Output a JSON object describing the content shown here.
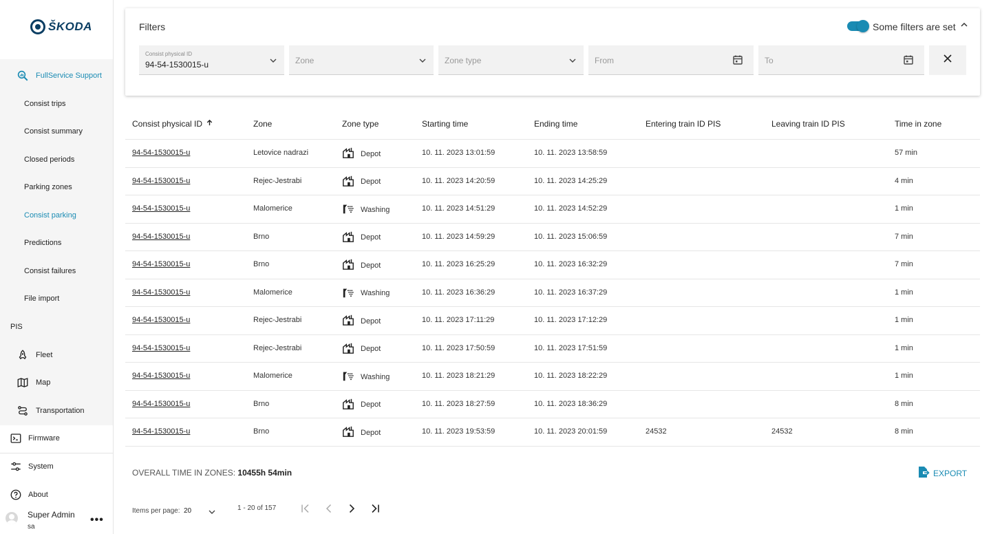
{
  "brand": {
    "name": "ŠKODA"
  },
  "sidebar": {
    "fullservice": {
      "label": "FullService Support"
    },
    "items": [
      {
        "label": "Consist trips"
      },
      {
        "label": "Consist summary"
      },
      {
        "label": "Closed periods"
      },
      {
        "label": "Parking zones"
      },
      {
        "label": "Consist parking",
        "active": true
      },
      {
        "label": "Predictions"
      },
      {
        "label": "Consist failures"
      },
      {
        "label": "File import"
      }
    ],
    "pis_label": "PIS",
    "pis_items": [
      {
        "label": "Fleet",
        "icon": "rocket-icon"
      },
      {
        "label": "Map",
        "icon": "map-icon"
      },
      {
        "label": "Transportation",
        "icon": "route-icon"
      }
    ],
    "firmware": {
      "label": "Firmware"
    },
    "system": {
      "label": "System"
    },
    "about": {
      "label": "About"
    },
    "user": {
      "name": "Super Admin",
      "login": "sa"
    }
  },
  "filters": {
    "title": "Filters",
    "toggle_label": "Some filters are set",
    "consist_id": {
      "label": "Consist physical ID",
      "value": "94-54-1530015-u"
    },
    "zone": {
      "placeholder": "Zone"
    },
    "zone_type": {
      "placeholder": "Zone type"
    },
    "from": {
      "placeholder": "From"
    },
    "to": {
      "placeholder": "To"
    }
  },
  "table": {
    "columns": [
      "Consist physical ID",
      "Zone",
      "Zone type",
      "Starting time",
      "Ending time",
      "Entering train ID PIS",
      "Leaving train ID PIS",
      "Time in zone"
    ],
    "rows": [
      {
        "id": "94-54-1530015-u",
        "zone": "Letovice nadrazi",
        "type": "Depot",
        "start": "10. 11. 2023 13:01:59",
        "end": "10. 11. 2023 13:58:59",
        "enter": "",
        "leave": "",
        "time": "57 min"
      },
      {
        "id": "94-54-1530015-u",
        "zone": "Rejec-Jestrabi",
        "type": "Depot",
        "start": "10. 11. 2023 14:20:59",
        "end": "10. 11. 2023 14:25:29",
        "enter": "",
        "leave": "",
        "time": "4 min"
      },
      {
        "id": "94-54-1530015-u",
        "zone": "Malomerice",
        "type": "Washing",
        "start": "10. 11. 2023 14:51:29",
        "end": "10. 11. 2023 14:52:29",
        "enter": "",
        "leave": "",
        "time": "1 min"
      },
      {
        "id": "94-54-1530015-u",
        "zone": "Brno",
        "type": "Depot",
        "start": "10. 11. 2023 14:59:29",
        "end": "10. 11. 2023 15:06:59",
        "enter": "",
        "leave": "",
        "time": "7 min"
      },
      {
        "id": "94-54-1530015-u",
        "zone": "Brno",
        "type": "Depot",
        "start": "10. 11. 2023 16:25:29",
        "end": "10. 11. 2023 16:32:29",
        "enter": "",
        "leave": "",
        "time": "7 min"
      },
      {
        "id": "94-54-1530015-u",
        "zone": "Malomerice",
        "type": "Washing",
        "start": "10. 11. 2023 16:36:29",
        "end": "10. 11. 2023 16:37:29",
        "enter": "",
        "leave": "",
        "time": "1 min"
      },
      {
        "id": "94-54-1530015-u",
        "zone": "Rejec-Jestrabi",
        "type": "Depot",
        "start": "10. 11. 2023 17:11:29",
        "end": "10. 11. 2023 17:12:29",
        "enter": "",
        "leave": "",
        "time": "1 min"
      },
      {
        "id": "94-54-1530015-u",
        "zone": "Rejec-Jestrabi",
        "type": "Depot",
        "start": "10. 11. 2023 17:50:59",
        "end": "10. 11. 2023 17:51:59",
        "enter": "",
        "leave": "",
        "time": "1 min"
      },
      {
        "id": "94-54-1530015-u",
        "zone": "Malomerice",
        "type": "Washing",
        "start": "10. 11. 2023 18:21:29",
        "end": "10. 11. 2023 18:22:29",
        "enter": "",
        "leave": "",
        "time": "1 min"
      },
      {
        "id": "94-54-1530015-u",
        "zone": "Brno",
        "type": "Depot",
        "start": "10. 11. 2023 18:27:59",
        "end": "10. 11. 2023 18:36:29",
        "enter": "",
        "leave": "",
        "time": "8 min"
      },
      {
        "id": "94-54-1530015-u",
        "zone": "Brno",
        "type": "Depot",
        "start": "10. 11. 2023 19:53:59",
        "end": "10. 11. 2023 20:01:59",
        "enter": "24532",
        "leave": "24532",
        "time": "8 min"
      }
    ]
  },
  "summary": {
    "label": "OVERALL TIME IN ZONES:",
    "value": "10455h 54min"
  },
  "export": {
    "label": "EXPORT"
  },
  "pager": {
    "items_per_page_label": "Items per page:",
    "items_per_page": "20",
    "range": "1 - 20 of 157"
  },
  "colors": {
    "accent": "#1a8bb3",
    "brand": "#0b3e63"
  }
}
